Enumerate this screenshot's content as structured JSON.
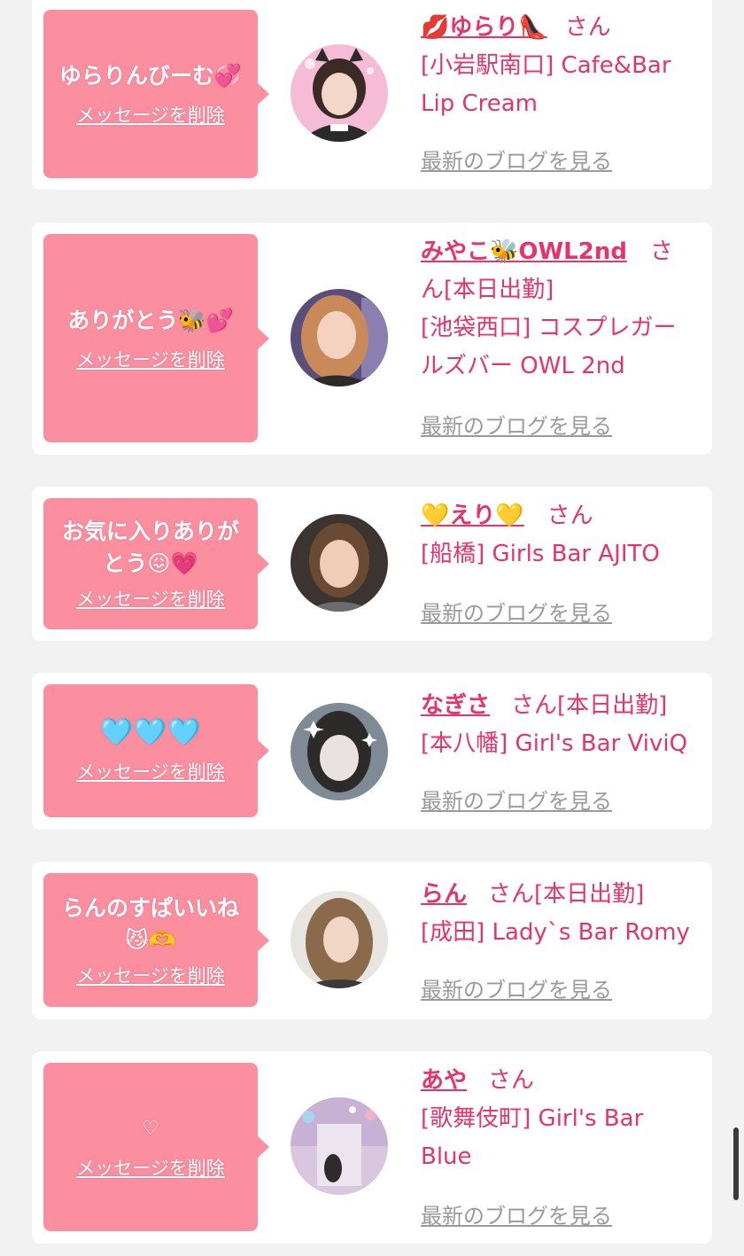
{
  "cards": [
    {
      "message": "ゆらりんびーむ💞",
      "delete_label": "メッセージを削除",
      "name": "💋ゆらり👠",
      "san": "さん",
      "shop_line1": "[小岩駅南口] Cafe&Bar",
      "shop_line2": "Lip Cream",
      "blog_label": "最新のブログを見る"
    },
    {
      "message": "ありがとう🐝💕",
      "delete_label": "メッセージを削除",
      "name": "みやこ🐝OWL2nd",
      "san_line": "さ",
      "line2": "ん[本日出勤]",
      "shop_line1": "[池袋西口] コスプレガー",
      "shop_line2": "ルズバー OWL 2nd",
      "blog_label": "最新のブログを見る"
    },
    {
      "message_line1": "お気に入りありが",
      "message_line2": "とう😖💗",
      "delete_label": "メッセージを削除",
      "name": "💛えり💛",
      "san": "さん",
      "shop_line1": "[船橋] Girls Bar AJITO",
      "blog_label": "最新のブログを見る"
    },
    {
      "message": "🩵🩵🩵",
      "delete_label": "メッセージを削除",
      "name": "なぎさ",
      "san": "さん[本日出勤]",
      "shop_line1": "[本八幡] Girl's Bar ViviQ",
      "blog_label": "最新のブログを見る"
    },
    {
      "message_line1": "らんのすぱいいね",
      "message_line2": "😼🫶",
      "delete_label": "メッセージを削除",
      "name": "らん",
      "san": "さん[本日出勤]",
      "shop_line1": "[成田] Lady`s Bar Romy",
      "blog_label": "最新のブログを見る"
    },
    {
      "message": "♡",
      "delete_label": "メッセージを削除",
      "name": "あや",
      "san": "さん",
      "shop_line1": "[歌舞伎町] Girl's Bar",
      "shop_line2": "Blue",
      "blog_label": "最新のブログを見る"
    }
  ],
  "colors": {
    "accent": "#e8336a",
    "bubble": "#fb8fa0",
    "background": "#f2f2f2",
    "link_gray": "#9a9a9a"
  }
}
